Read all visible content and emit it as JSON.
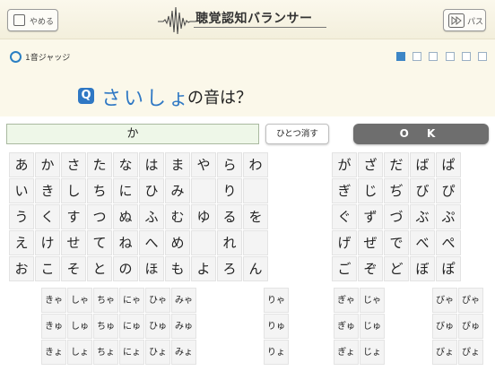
{
  "header": {
    "quit_label": "やめる",
    "title": "聴覚認知バランサー",
    "pass_label": "パス"
  },
  "mode_label": "1音ジャッジ",
  "progress": {
    "total": 6,
    "current": 1
  },
  "question": {
    "icon": "Q",
    "word": "さいしょ",
    "suffix": "の音は？"
  },
  "answer_value": "か",
  "undo_label": "ひとつ消す",
  "ok_label": "O K",
  "kana_rows": [
    [
      "あ",
      "か",
      "さ",
      "た",
      "な",
      "は",
      "ま",
      "や",
      "ら",
      "わ"
    ],
    [
      "い",
      "き",
      "し",
      "ち",
      "に",
      "ひ",
      "み",
      "",
      "り",
      ""
    ],
    [
      "う",
      "く",
      "す",
      "つ",
      "ぬ",
      "ふ",
      "む",
      "ゆ",
      "る",
      "を"
    ],
    [
      "え",
      "け",
      "せ",
      "て",
      "ね",
      "へ",
      "め",
      "",
      "れ",
      ""
    ],
    [
      "お",
      "こ",
      "そ",
      "と",
      "の",
      "ほ",
      "も",
      "よ",
      "ろ",
      "ん"
    ]
  ],
  "voiced_rows": [
    [
      "が",
      "ざ",
      "だ",
      "ば",
      "ぱ"
    ],
    [
      "ぎ",
      "じ",
      "ぢ",
      "び",
      "ぴ"
    ],
    [
      "ぐ",
      "ず",
      "づ",
      "ぶ",
      "ぷ"
    ],
    [
      "げ",
      "ぜ",
      "で",
      "べ",
      "ぺ"
    ],
    [
      "ご",
      "ぞ",
      "ど",
      "ぼ",
      "ぽ"
    ]
  ],
  "yoon_rows": [
    [
      "きゃ",
      "しゃ",
      "ちゃ",
      "にゃ",
      "ひゃ",
      "みゃ"
    ],
    [
      "きゅ",
      "しゅ",
      "ちゅ",
      "にゅ",
      "ひゅ",
      "みゅ"
    ],
    [
      "きょ",
      "しょ",
      "ちょ",
      "にょ",
      "ひょ",
      "みょ"
    ]
  ],
  "ryo_rows": [
    "りゃ",
    "りゅ",
    "りょ"
  ],
  "voiced_yoon_rows": [
    [
      "ぎゃ",
      "じゃ"
    ],
    [
      "ぎゅ",
      "じゅ"
    ],
    [
      "ぎょ",
      "じょ"
    ]
  ],
  "b_yoon_rows": [
    [
      "びゃ",
      "ぴゃ"
    ],
    [
      "びゅ",
      "ぴゅ"
    ],
    [
      "びょ",
      "ぴょ"
    ]
  ]
}
